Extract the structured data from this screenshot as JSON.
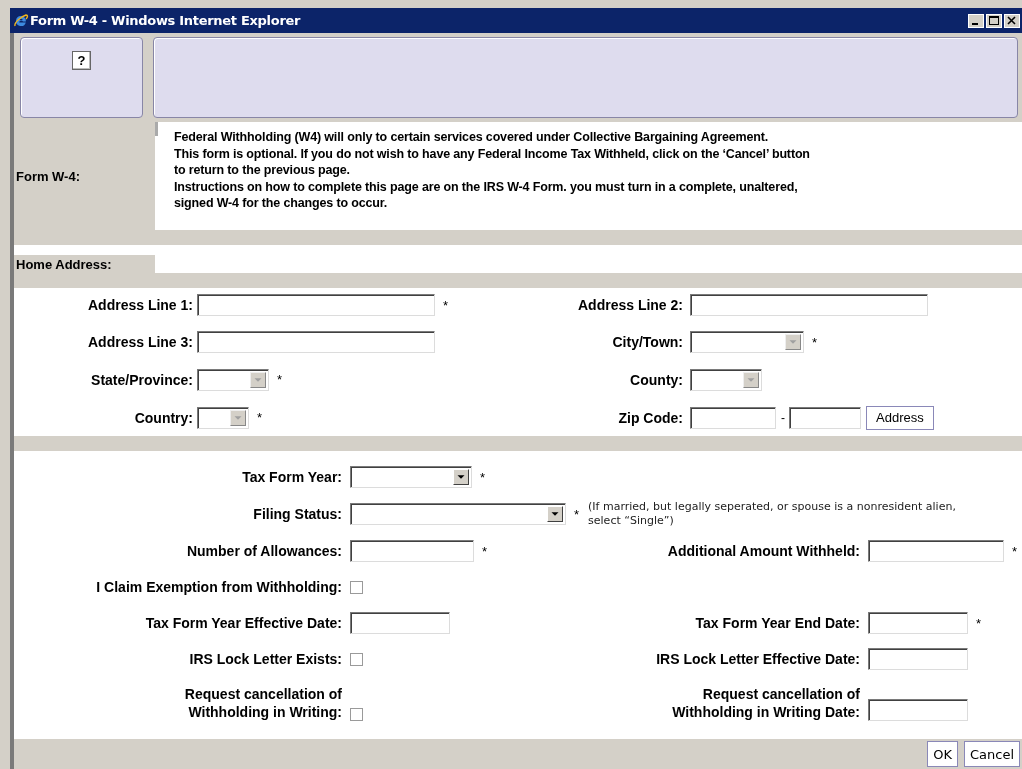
{
  "window": {
    "title": "Form W-4  - Windows Internet Explorer"
  },
  "help_button": "?",
  "intro": {
    "label": "Form W-4:",
    "lines": [
      "Federal Withholding (W4) will only to certain services covered under Collective Bargaining Agreement.",
      "This form is optional. If you do not wish to have any Federal Income Tax Withheld, click on the ‘Cancel’ button",
      "to return to the previous page.",
      "Instructions on how to complete this page are on the IRS W-4 Form. you must turn in a complete, unaltered,",
      "signed W-4 for the changes to occur."
    ]
  },
  "home_address": {
    "label": "Home Address:",
    "rows": [
      {
        "left": {
          "label": "Address Line 1:",
          "kind": "text",
          "mark": "*"
        },
        "right": {
          "label": "Address Line 2:",
          "kind": "text"
        }
      },
      {
        "left": {
          "label": "Address Line 3:",
          "kind": "text"
        },
        "right": {
          "label": "City/Town:",
          "kind": "select",
          "disabled": true,
          "mark": "*"
        }
      },
      {
        "left": {
          "label": "State/Province:",
          "kind": "select",
          "disabled": true,
          "mark": "*"
        },
        "right": {
          "label": "County:",
          "kind": "select",
          "disabled": true
        }
      },
      {
        "left": {
          "label": "Country:",
          "kind": "select",
          "disabled": true,
          "mark": "*"
        },
        "right": {
          "label": "Zip Code:",
          "kind": "zip",
          "separator": "-",
          "button": "Address"
        }
      }
    ]
  },
  "tax": {
    "rows": [
      {
        "left": {
          "label": "Tax Form Year:",
          "kind": "select",
          "disabled": false,
          "mark": "*"
        }
      },
      {
        "left": {
          "label": "Filing Status:",
          "kind": "select",
          "disabled": false,
          "mark": "*",
          "note": "(If married, but legally seperated, or spouse is a nonresident alien, select “Single”)"
        }
      },
      {
        "left": {
          "label": "Number of Allowances:",
          "kind": "text",
          "mark": "*"
        },
        "right": {
          "label": "Additional Amount Withheld:",
          "kind": "text",
          "mark": "*"
        }
      },
      {
        "left": {
          "label": "I Claim Exemption from Withholding:",
          "kind": "checkbox",
          "checked": false
        }
      },
      {
        "left": {
          "label": "Tax Form Year Effective Date:",
          "kind": "text"
        },
        "right": {
          "label": "Tax Form Year End Date:",
          "kind": "text",
          "mark": "*"
        }
      },
      {
        "left": {
          "label": "IRS Lock Letter Exists:",
          "kind": "checkbox",
          "checked": false
        },
        "right": {
          "label": "IRS Lock Letter Effective Date:",
          "kind": "text"
        }
      },
      {
        "left": {
          "label": "Request cancellation of Withholding in Writing:",
          "kind": "checkbox",
          "checked": false
        },
        "right": {
          "label": "Request cancellation of Withholding in Writing Date:",
          "kind": "text"
        }
      }
    ]
  },
  "buttons": [
    {
      "label": "OK"
    },
    {
      "label": "Cancel"
    }
  ]
}
